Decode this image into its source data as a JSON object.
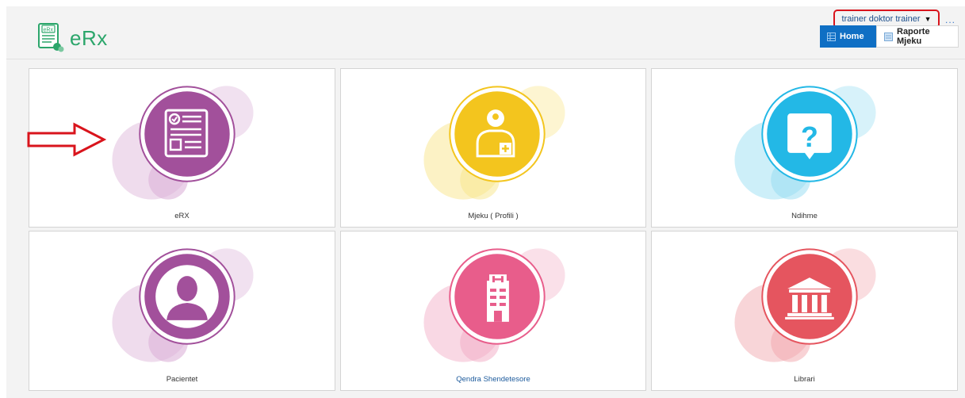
{
  "app": {
    "logo_text": "eRx",
    "logo_icon": "prescription-document-icon"
  },
  "header": {
    "user_name": "trainer doktor trainer",
    "more": "...",
    "nav": [
      {
        "label": "Home",
        "icon": "home-grid-icon",
        "active": true
      },
      {
        "label": "Raporte Mjeku",
        "icon": "report-icon",
        "active": false
      }
    ]
  },
  "tiles": [
    {
      "label": "eRX",
      "icon": "prescription-form-icon",
      "color": "#a2509b",
      "light": "#e8cde6"
    },
    {
      "label": "Mjeku ( Profili )",
      "icon": "doctor-profile-icon",
      "color": "#f3c51e",
      "light": "#fbeeb2"
    },
    {
      "label": "Ndihme",
      "icon": "help-question-icon",
      "color": "#23b8e6",
      "light": "#bce9f7"
    },
    {
      "label": "Pacientet",
      "icon": "patient-person-icon",
      "color": "#a2509b",
      "light": "#e8cde6"
    },
    {
      "label": "Qendra Shendetesore",
      "icon": "hospital-building-icon",
      "color": "#e85d8b",
      "light": "#f7cbdb"
    },
    {
      "label": "Librari",
      "icon": "library-building-icon",
      "color": "#e5555f",
      "light": "#f6c7cb"
    }
  ],
  "annotation": {
    "arrow_color": "#d9141c",
    "highlight_color": "#d9141c"
  }
}
